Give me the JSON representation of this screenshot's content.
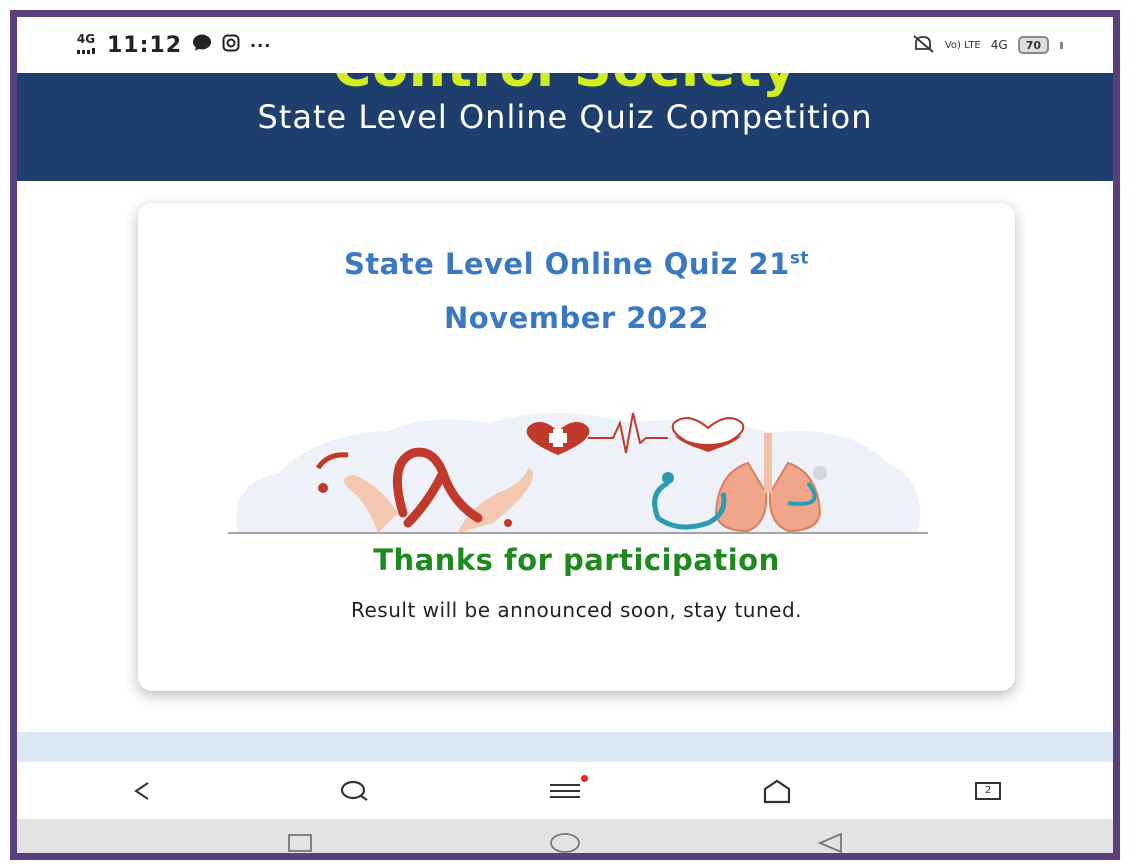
{
  "status_bar": {
    "network": "4G",
    "time": "11:12",
    "more": "···",
    "carrier": "Vo) LTE",
    "right_network": "4G",
    "battery": "70",
    "icons": [
      "signal-icon",
      "chat-icon",
      "instagram-icon",
      "mute-icon"
    ]
  },
  "header": {
    "org_name": "Control Society",
    "title": "State Level Online Quiz Competition"
  },
  "card": {
    "title_main": "State Level Online Quiz 21",
    "title_sup": "st",
    "title_date": "November 2022",
    "thanks": "Thanks for participation",
    "message": "Result will be announced soon, stay tuned."
  },
  "browser_nav": {
    "tabs_count": "2",
    "icons": [
      "back-icon",
      "search-icon",
      "menu-icon",
      "home-icon",
      "tabs-icon"
    ]
  },
  "system_nav": {
    "icons": [
      "recents-icon",
      "home-circle-icon",
      "back-triangle-icon"
    ]
  },
  "colors": {
    "frame": "#5a3f7c",
    "banner": "#1e3f6e",
    "org_text": "#d4ec22",
    "card_title": "#3a78c2",
    "thanks": "#1e8a1e"
  }
}
